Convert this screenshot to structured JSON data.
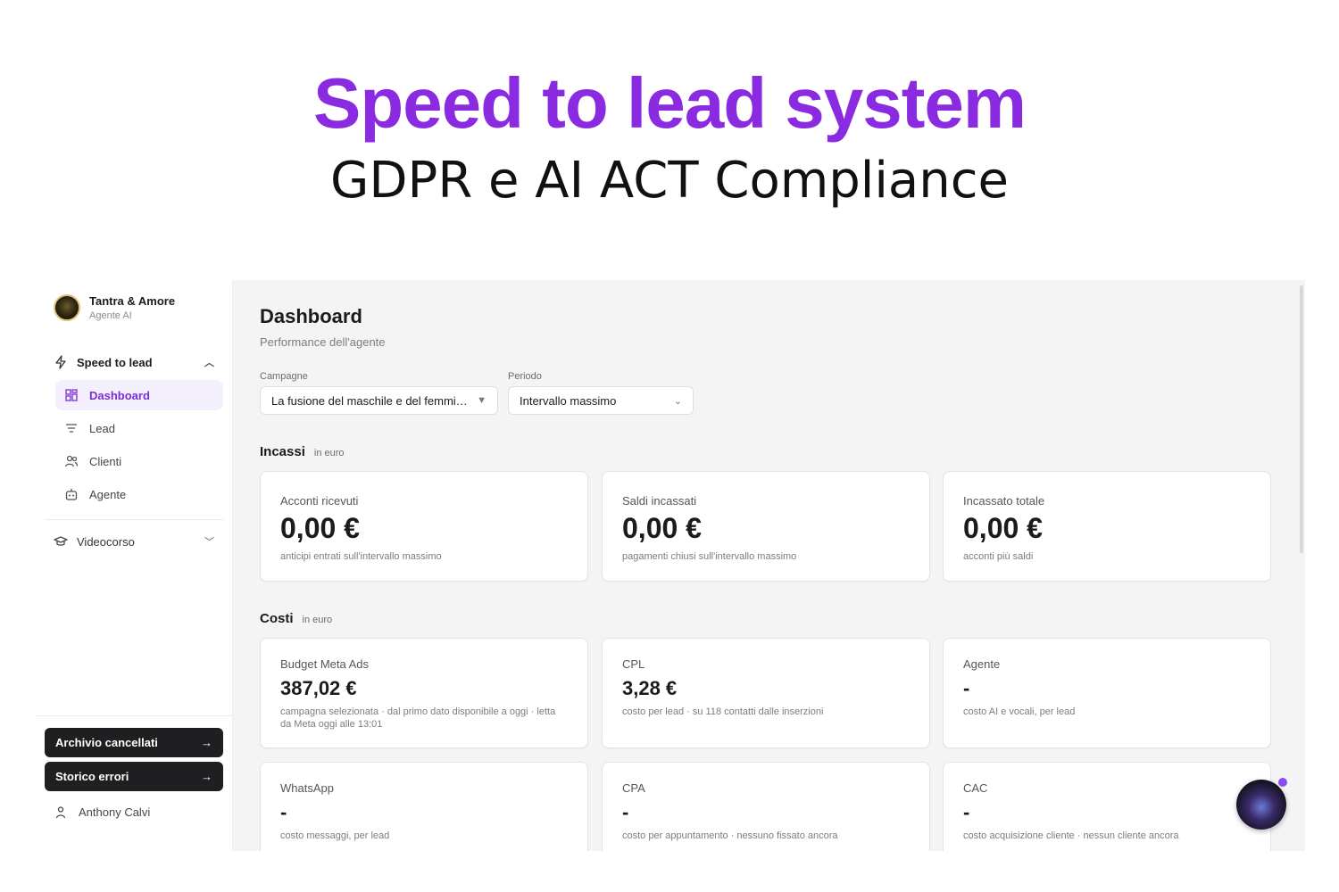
{
  "hero": {
    "title": "Speed to lead system",
    "subtitle": "GDPR e AI ACT Compliance"
  },
  "brand": {
    "name": "Tantra & Amore",
    "role": "Agente AI"
  },
  "sidebar": {
    "section1": "Speed to lead",
    "items": [
      {
        "label": "Dashboard",
        "icon": "grid-icon",
        "active": true
      },
      {
        "label": "Lead",
        "icon": "filter-icon",
        "active": false
      },
      {
        "label": "Clienti",
        "icon": "users-icon",
        "active": false
      },
      {
        "label": "Agente",
        "icon": "bot-icon",
        "active": false
      }
    ],
    "section2": "Videocorso",
    "archive_button": "Archivio cancellati",
    "errors_button": "Storico errori",
    "user_name": "Anthony Calvi"
  },
  "main": {
    "title": "Dashboard",
    "subtitle": "Performance dell'agente",
    "campaign_label": "Campagne",
    "campaign_value": "La fusione del maschile e del femmi…",
    "period_label": "Periodo",
    "period_value": "Intervallo massimo"
  },
  "incassi": {
    "title": "Incassi",
    "unit": "in euro",
    "cards": [
      {
        "label": "Acconti ricevuti",
        "value": "0,00 €",
        "note": "anticipi entrati sull'intervallo massimo"
      },
      {
        "label": "Saldi incassati",
        "value": "0,00 €",
        "note": "pagamenti chiusi sull'intervallo massimo"
      },
      {
        "label": "Incassato totale",
        "value": "0,00 €",
        "note": "acconti più saldi"
      }
    ]
  },
  "costi": {
    "title": "Costi",
    "unit": "in euro",
    "cards": [
      {
        "label": "Budget Meta Ads",
        "value": "387,02 €",
        "note": "campagna selezionata · dal primo dato disponibile a oggi · letta da Meta oggi alle 13:01"
      },
      {
        "label": "CPL",
        "value": "3,28 €",
        "note": "costo per lead · su 118 contatti dalle inserzioni"
      },
      {
        "label": "Agente",
        "value": "-",
        "note": "costo AI e vocali, per lead"
      },
      {
        "label": "WhatsApp",
        "value": "-",
        "note": "costo messaggi, per lead"
      },
      {
        "label": "CPA",
        "value": "-",
        "note": "costo per appuntamento · nessuno fissato ancora"
      },
      {
        "label": "CAC",
        "value": "-",
        "note": "costo acquisizione cliente · nessun cliente ancora"
      }
    ]
  },
  "colors": {
    "accent": "#8a2be2",
    "active_nav_bg": "#f3effc",
    "dark_button": "#1f1f22"
  }
}
